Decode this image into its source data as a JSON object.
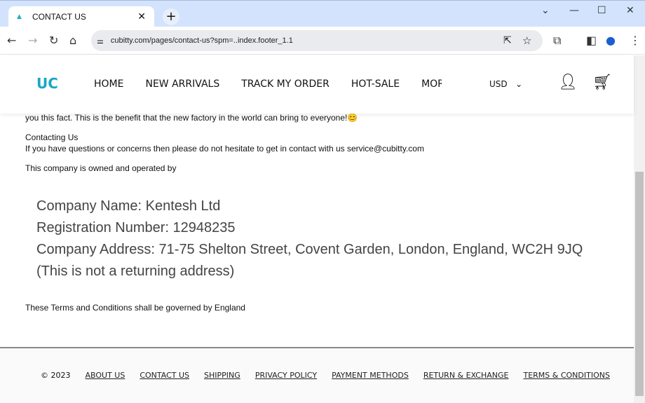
{
  "browser": {
    "tab_title": "CONTACT US",
    "url": "cubitty.com/pages/contact-us?spm=..index.footer_1.1"
  },
  "header": {
    "logo": "UC",
    "nav": [
      "HOME",
      "NEW ARRIVALS",
      "TRACK MY ORDER",
      "HOT-SALE",
      "MORE LIN"
    ],
    "currency": "USD"
  },
  "content": {
    "intro_tail": "you this fact. This is the benefit that the new factory in the world can bring to everyone!😊",
    "contact_heading": "Contacting Us",
    "contact_text": "If you have questions or concerns then please do not hesitate to get in contact with us service@cubitty.com",
    "owned_by": "This company is owned and operated by",
    "company_lines": [
      "Company Name: Kentesh Ltd",
      "Registration Number: 12948235",
      "Company Address: 71-75 Shelton Street, Covent Garden, London, England, WC2H 9JQ",
      "(This is not a returning address)"
    ],
    "governed": "These Terms and Conditions shall be governed by England"
  },
  "footer": {
    "copyright": "© 2023",
    "links": [
      "ABOUT US",
      "CONTACT US",
      "SHIPPING",
      "PRIVACY POLICY",
      "PAYMENT METHODS",
      "RETURN & EXCHANGE",
      "TERMS & CONDITIONS"
    ]
  }
}
